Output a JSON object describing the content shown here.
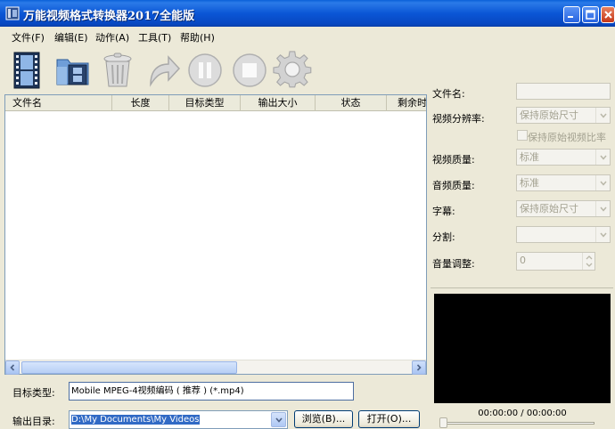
{
  "window": {
    "title": "万能视频格式转换器2017全能版"
  },
  "menu": [
    {
      "label": "文件(F)"
    },
    {
      "label": "编辑(E)"
    },
    {
      "label": "动作(A)"
    },
    {
      "label": "工具(T)"
    },
    {
      "label": "帮助(H)"
    }
  ],
  "toolbar": {
    "icons": [
      "film-icon",
      "folder-film-icon",
      "trash-icon",
      "redo-arrow-icon",
      "pause-icon",
      "stop-icon",
      "gear-icon"
    ]
  },
  "file_list": {
    "columns": [
      "文件名",
      "长度",
      "目标类型",
      "输出大小",
      "状态",
      "剩余时"
    ],
    "rows": []
  },
  "bottom": {
    "target_type_label": "目标类型:",
    "target_type_value": "Mobile MPEG-4视频编码 ( 推荐 ) (*.mp4)",
    "output_dir_label": "输出目录:",
    "output_dir_value": "D:\\My Documents\\My Videos",
    "browse_label": "浏览(B)...",
    "open_label": "打开(O)..."
  },
  "settings": {
    "filename_label": "文件名:",
    "filename_value": "",
    "resolution_label": "视频分辨率:",
    "resolution_value": "保持原始尺寸",
    "keep_ratio_label": "保持原始视频比率",
    "video_quality_label": "视频质量:",
    "video_quality_value": "标准",
    "audio_quality_label": "音频质量:",
    "audio_quality_value": "标准",
    "subtitle_label": "字幕:",
    "subtitle_value": "保持原始尺寸",
    "split_label": "分割:",
    "split_value": "",
    "volume_label": "音量调整:",
    "volume_value": "0"
  },
  "player": {
    "timecode": "00:00:00 / 00:00:00"
  }
}
